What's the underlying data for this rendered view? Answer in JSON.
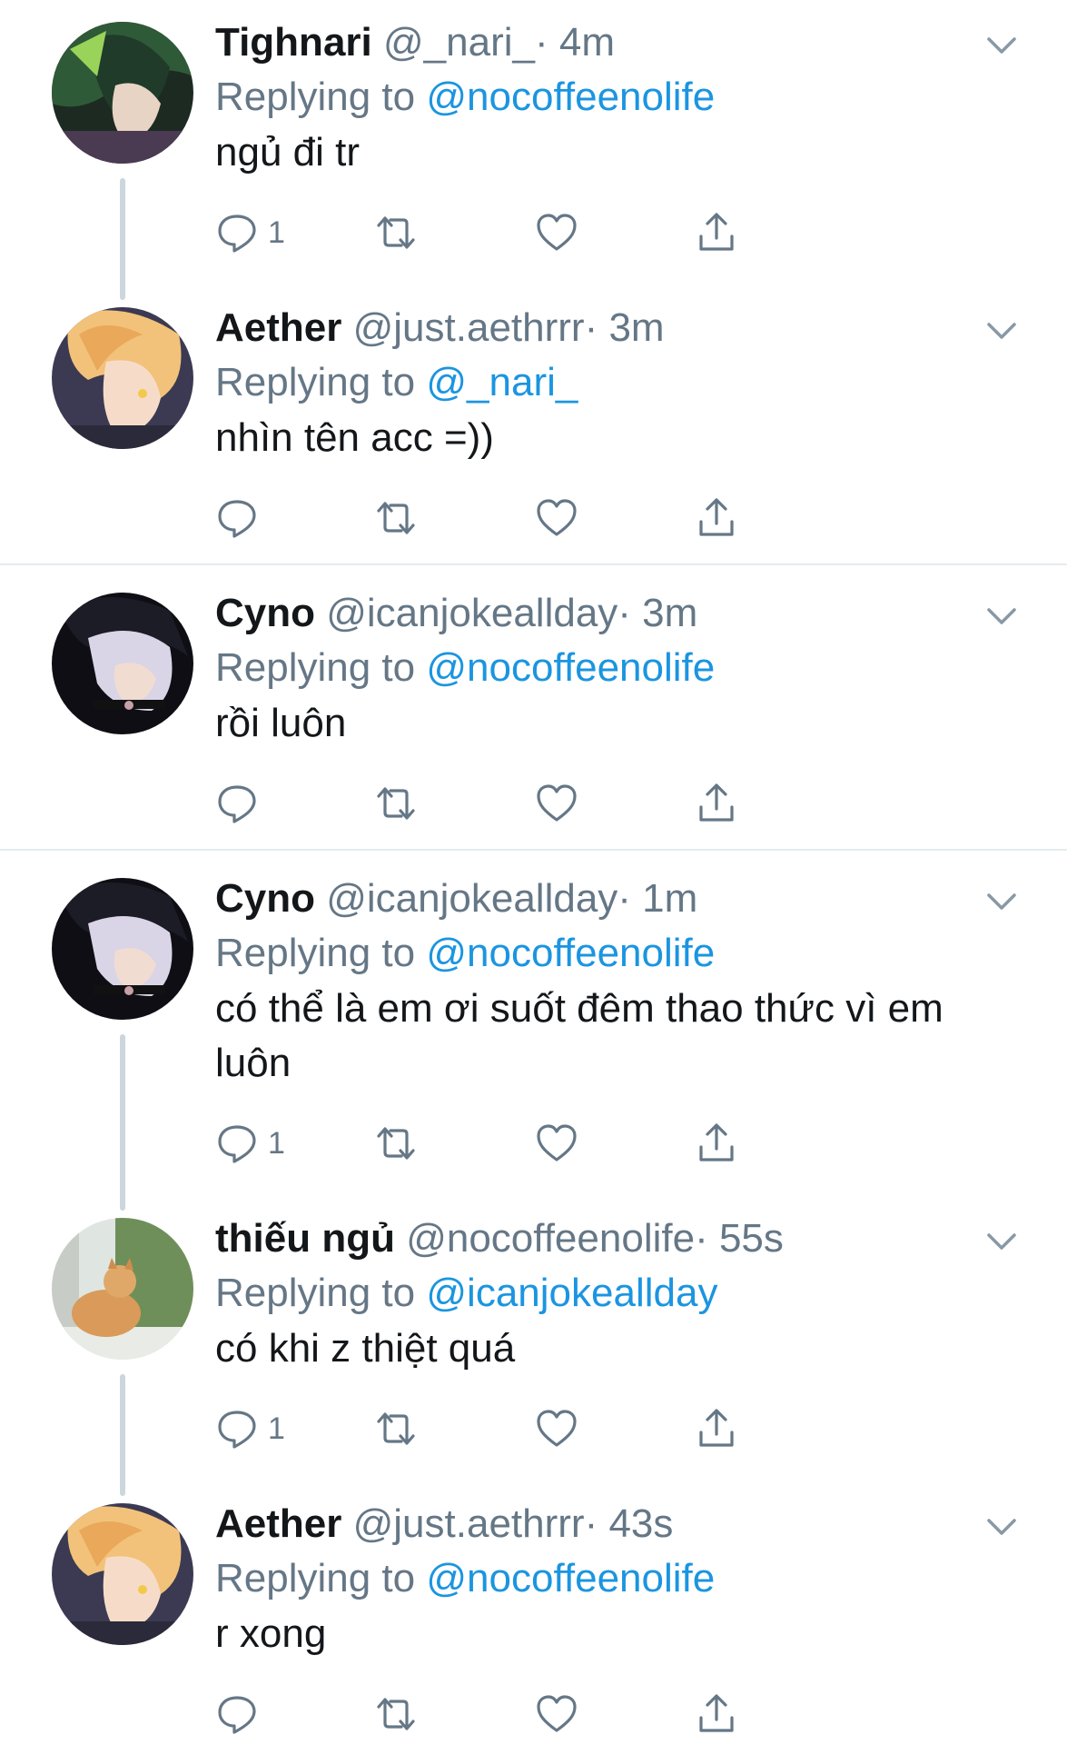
{
  "tweets": [
    {
      "name": "Tighnari",
      "handle": "@_nari_",
      "time": "· 4m",
      "reply_prefix": "Replying to",
      "reply_to": "@nocoffeenolife",
      "text": "ngủ đi tr",
      "reply_count": "1",
      "avatar": "tighnari-avatar"
    },
    {
      "name": "Aether",
      "handle": "@just.aethrrr",
      "time": "· 3m",
      "reply_prefix": "Replying to",
      "reply_to": "@_nari_",
      "text": "nhìn tên acc =))",
      "reply_count": "",
      "avatar": "aether-avatar"
    },
    {
      "name": "Cyno",
      "handle": "@icanjokeallday",
      "time": "· 3m",
      "reply_prefix": "Replying to",
      "reply_to": "@nocoffeenolife",
      "text": "rồi luôn",
      "reply_count": "",
      "avatar": "cyno-avatar"
    },
    {
      "name": "Cyno",
      "handle": "@icanjokeallday",
      "time": "· 1m",
      "reply_prefix": "Replying to",
      "reply_to": "@nocoffeenolife",
      "text": "có thể là em ơi suốt đêm thao thức vì em luôn",
      "reply_count": "1",
      "avatar": "cyno-avatar"
    },
    {
      "name": "thiếu ngủ",
      "handle": "@nocoffeenolife",
      "time": "· 55s",
      "reply_prefix": "Replying to",
      "reply_to": "@icanjokeallday",
      "text": "có khi z thiệt quá",
      "reply_count": "1",
      "avatar": "cat-avatar"
    },
    {
      "name": "Aether",
      "handle": "@just.aethrrr",
      "time": "· 43s",
      "reply_prefix": "Replying to",
      "reply_to": "@nocoffeenolife",
      "text": "r xong",
      "reply_count": "",
      "avatar": "aether-avatar"
    }
  ],
  "icons": {
    "reply": "reply-icon",
    "retweet": "retweet-icon",
    "like": "heart-icon",
    "share": "share-icon",
    "menu": "chevron-down-icon"
  },
  "colors": {
    "text": "#14171a",
    "muted": "#657786",
    "link": "#1b95e0",
    "thread_line": "#ccd6dd",
    "divider": "#e6ecf0"
  }
}
